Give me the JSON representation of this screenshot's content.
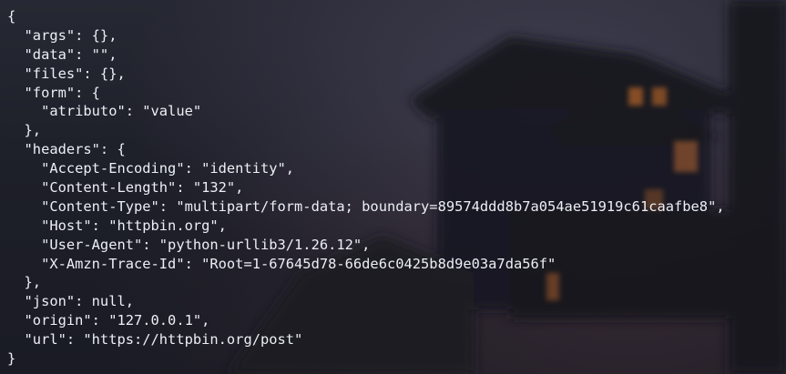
{
  "terminal": {
    "lines": [
      "{",
      "  \"args\": {},",
      "  \"data\": \"\",",
      "  \"files\": {},",
      "  \"form\": {",
      "    \"atributo\": \"value\"",
      "  },",
      "  \"headers\": {",
      "    \"Accept-Encoding\": \"identity\",",
      "    \"Content-Length\": \"132\",",
      "    \"Content-Type\": \"multipart/form-data; boundary=89574ddd8b7a054ae51919c61caafbe8\",",
      "    \"Host\": \"httpbin.org\",",
      "    \"User-Agent\": \"python-urllib3/1.26.12\",",
      "    \"X-Amzn-Trace-Id\": \"Root=1-67645d78-66de6c0425b8d9e03a7da56f\"",
      "  },",
      "  \"json\": null,",
      "  \"origin\": \"127.0.0.1\",",
      "  \"url\": \"https://httpbin.org/post\"",
      "}"
    ]
  },
  "colors": {
    "text": "#eceff4",
    "background": "#1d1f29",
    "window_glow": "#e0792c"
  }
}
